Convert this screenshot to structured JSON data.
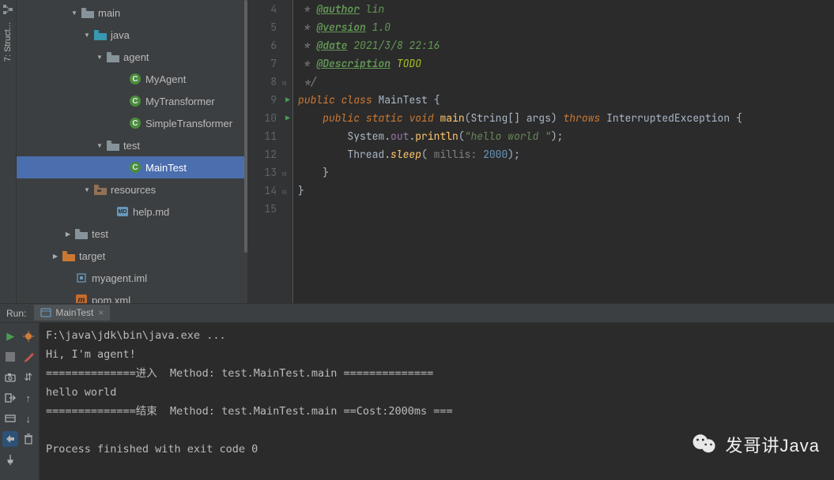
{
  "sidebar_left": {
    "label": "7: Struct..."
  },
  "tree": [
    {
      "indent": 68,
      "arrow": "▼",
      "icon": "folder",
      "iconColor": "#87939a",
      "label": "main"
    },
    {
      "indent": 84,
      "arrow": "▼",
      "icon": "folder",
      "iconColor": "#3898b0",
      "label": "java"
    },
    {
      "indent": 100,
      "arrow": "▼",
      "icon": "folder",
      "iconColor": "#87939a",
      "label": "agent"
    },
    {
      "indent": 128,
      "arrow": "",
      "icon": "class",
      "label": "MyAgent"
    },
    {
      "indent": 128,
      "arrow": "",
      "icon": "class",
      "label": "MyTransformer"
    },
    {
      "indent": 128,
      "arrow": "",
      "icon": "class",
      "label": "SimpleTransformer"
    },
    {
      "indent": 100,
      "arrow": "▼",
      "icon": "folder",
      "iconColor": "#87939a",
      "label": "test"
    },
    {
      "indent": 128,
      "arrow": "",
      "icon": "class",
      "label": "MainTest",
      "selected": true
    },
    {
      "indent": 84,
      "arrow": "▼",
      "icon": "folder-res",
      "label": "resources"
    },
    {
      "indent": 112,
      "arrow": "",
      "icon": "md",
      "label": "help.md"
    },
    {
      "indent": 60,
      "arrow": "▶",
      "icon": "folder",
      "iconColor": "#87939a",
      "label": "test"
    },
    {
      "indent": 44,
      "arrow": "▶",
      "icon": "folder",
      "iconColor": "#cc7832",
      "label": "target"
    },
    {
      "indent": 60,
      "arrow": "",
      "icon": "iml",
      "label": "myagent.iml"
    },
    {
      "indent": 60,
      "arrow": "",
      "icon": "maven",
      "label": "pom.xml"
    }
  ],
  "gutter": [
    {
      "n": "4"
    },
    {
      "n": "5"
    },
    {
      "n": "6"
    },
    {
      "n": "7"
    },
    {
      "n": "8",
      "fold": true
    },
    {
      "n": "9",
      "run": true,
      "fold": true
    },
    {
      "n": "10",
      "run": true,
      "fold": true
    },
    {
      "n": "11"
    },
    {
      "n": "12"
    },
    {
      "n": "13",
      "fold": true
    },
    {
      "n": "14",
      "fold": true
    },
    {
      "n": "15"
    }
  ],
  "code": {
    "author_tag": "@author",
    "author_val": "lin",
    "version_tag": "@version",
    "version_val": "1.0",
    "date_tag": "@date",
    "date_val": "2021/3/8 22:16",
    "desc_tag": "@Description",
    "desc_val": "TODO",
    "l8": " */",
    "kw_public": "public",
    "kw_class": "class",
    "cls_name": "MainTest",
    "brace_open": " {",
    "kw_static": "static",
    "kw_void": "void",
    "mth_main": "main",
    "paren_open": "(",
    "type_string": "String",
    "arr": "[] ",
    "arg_args": "args",
    "paren_close": ") ",
    "kw_throws": "throws",
    "exc": " InterruptedException",
    "brace_open2": " {",
    "sys": "System",
    "dot": ".",
    "out": "out",
    "println": "println",
    "hello": "\"hello world \"",
    "semi": ");",
    "thread": "Thread",
    "sleep": "sleep",
    "millis_hint": " millis: ",
    "millis_val": "2000",
    "semi2": ");",
    "brace_close": "}",
    "brace_close2": "}",
    "star": " * "
  },
  "run": {
    "label": "Run:",
    "tab": "MainTest",
    "lines": [
      "F:\\java\\jdk\\bin\\java.exe ...",
      "Hi, I'm agent!",
      "==============进入  Method: test.MainTest.main ==============",
      "hello world ",
      "==============结束  Method: test.MainTest.main ==Cost:2000ms ===",
      "",
      "Process finished with exit code 0"
    ]
  },
  "watermark": "发哥讲Java"
}
